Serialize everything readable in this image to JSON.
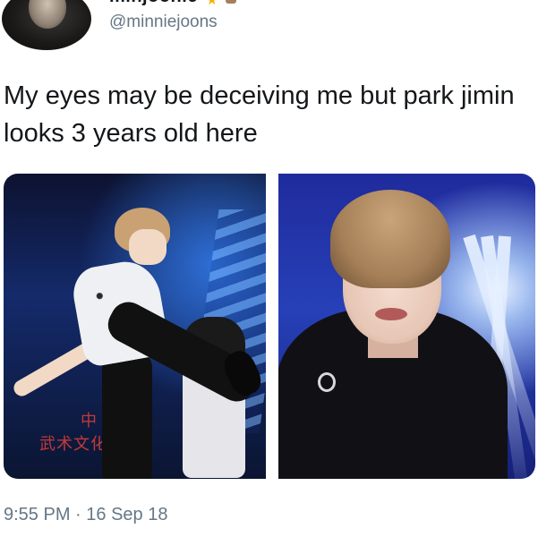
{
  "tweet": {
    "display_name": "minjoonie",
    "handle": "@minniejoons",
    "text": "My eyes may be deceiving me but park jimin looks 3 years old here",
    "time": "9:55 PM",
    "separator": "·",
    "date": "16 Sep 18"
  },
  "media": {
    "left_photo": {
      "sign_line_1": "中",
      "sign_line_2": "武术文化"
    }
  },
  "colors": {
    "text": "#14171a",
    "secondary": "#657786",
    "background": "#ffffff"
  },
  "icons": {
    "name_emoji_1": "star",
    "name_emoji_2": "emoji"
  }
}
